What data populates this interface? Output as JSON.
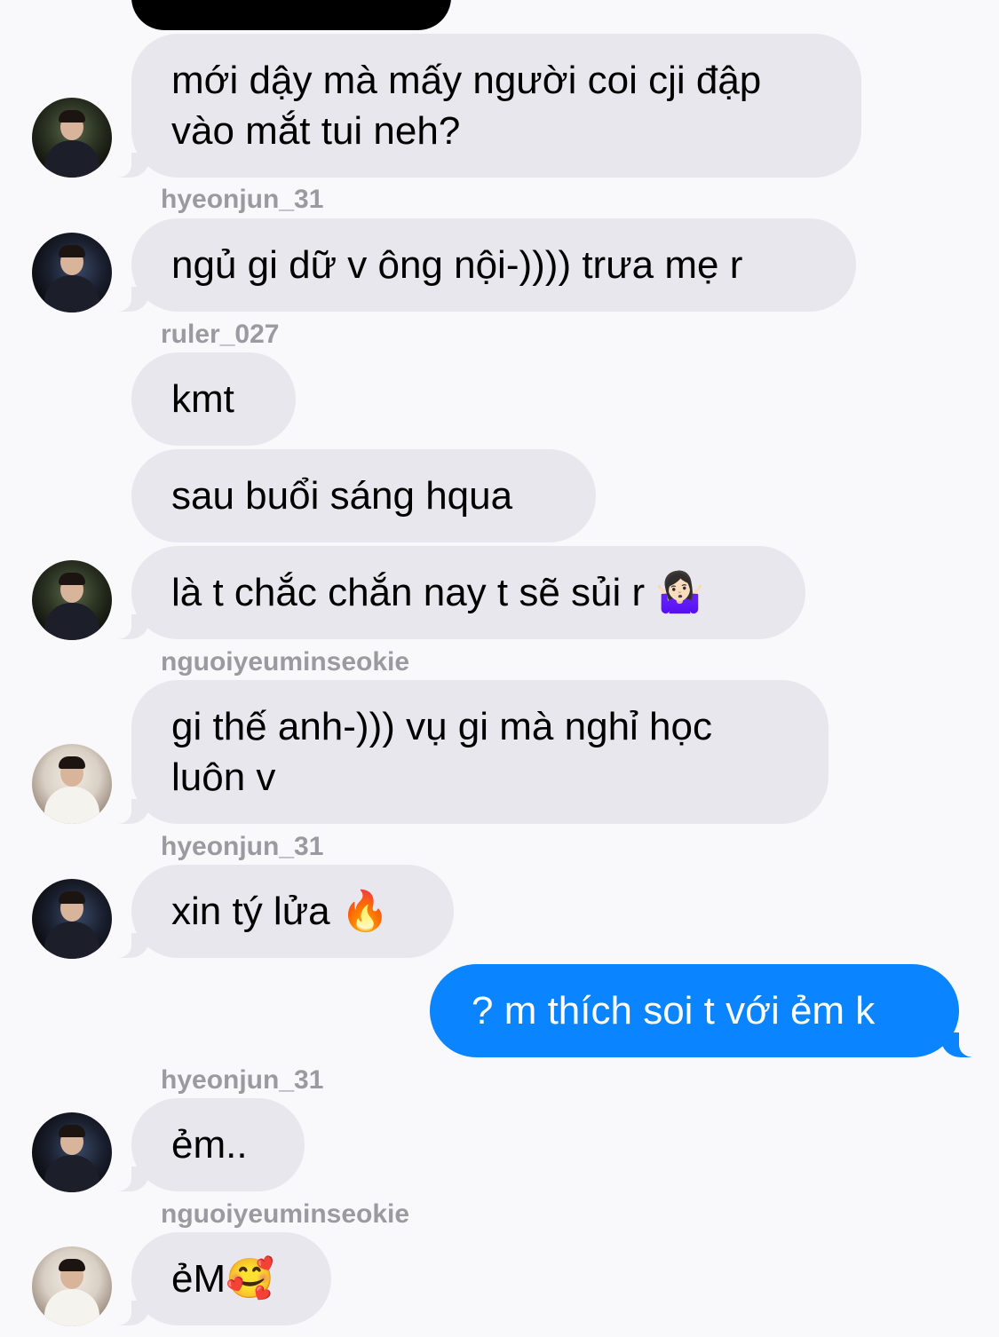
{
  "messages": [
    {
      "text": "mới dậy mà mấy người coi cji đập vào mắt tui neh?"
    },
    {
      "sender": "hyeonjun_31",
      "text": "ngủ gi dữ v ông nội-)))) trưa mẹ r"
    },
    {
      "sender": "ruler_027",
      "text": "kmt"
    },
    {
      "text": "sau buổi sáng hqua"
    },
    {
      "text": "là t chắc chắn nay t sẽ sủi r",
      "emoji": "🤷🏻‍♀️"
    },
    {
      "sender": "nguoiyeuminseokie",
      "text": "gi thế anh-))) vụ gi mà nghỉ học luôn v"
    },
    {
      "sender": "hyeonjun_31",
      "text": "xin tý lửa",
      "emoji": "🔥"
    },
    {
      "text": "? m thích soi t với ẻm k",
      "outgoing": true
    },
    {
      "sender": "hyeonjun_31",
      "text": "ẻm.."
    },
    {
      "sender": "nguoiyeuminseokie",
      "text": "ẻM",
      "emoji": "🥰"
    }
  ],
  "colors": {
    "incoming_bubble": "#e8e7ed",
    "outgoing_bubble": "#0a84ff",
    "background": "#f9f9fb",
    "sender_label": "#9a9aa0"
  }
}
